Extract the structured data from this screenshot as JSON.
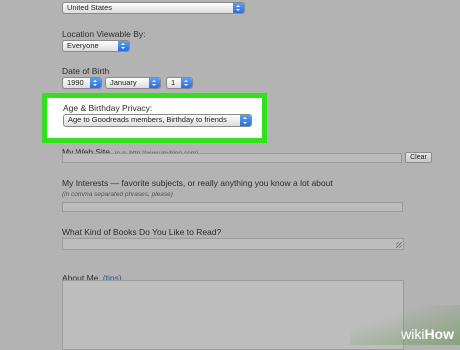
{
  "country": {
    "value": "United States"
  },
  "location_viewable": {
    "label": "Location Viewable By:",
    "value": "Everyone"
  },
  "date_of_birth": {
    "label": "Date of Birth",
    "year": "1990",
    "month": "January",
    "day": "1"
  },
  "age_privacy": {
    "label": "Age & Birthday Privacy:",
    "value": "Age to Goodreads members, Birthday to friends"
  },
  "web_site": {
    "label": "My Web Site",
    "hint": "(e.g. http://www.myblog.com)",
    "clear_label": "Clear"
  },
  "interests": {
    "label": "My Interests — favorite subjects, or really anything you know a lot about",
    "hint": "(in comma separated phrases, please)"
  },
  "books": {
    "label": "What Kind of Books Do You Like to Read?"
  },
  "about_me": {
    "label": "About Me",
    "tips": "(tips)"
  },
  "watermark": {
    "wiki": "wiki",
    "how": "How"
  },
  "colors": {
    "highlight": "#33e11a",
    "select_arrow": "#2a6fdc"
  }
}
